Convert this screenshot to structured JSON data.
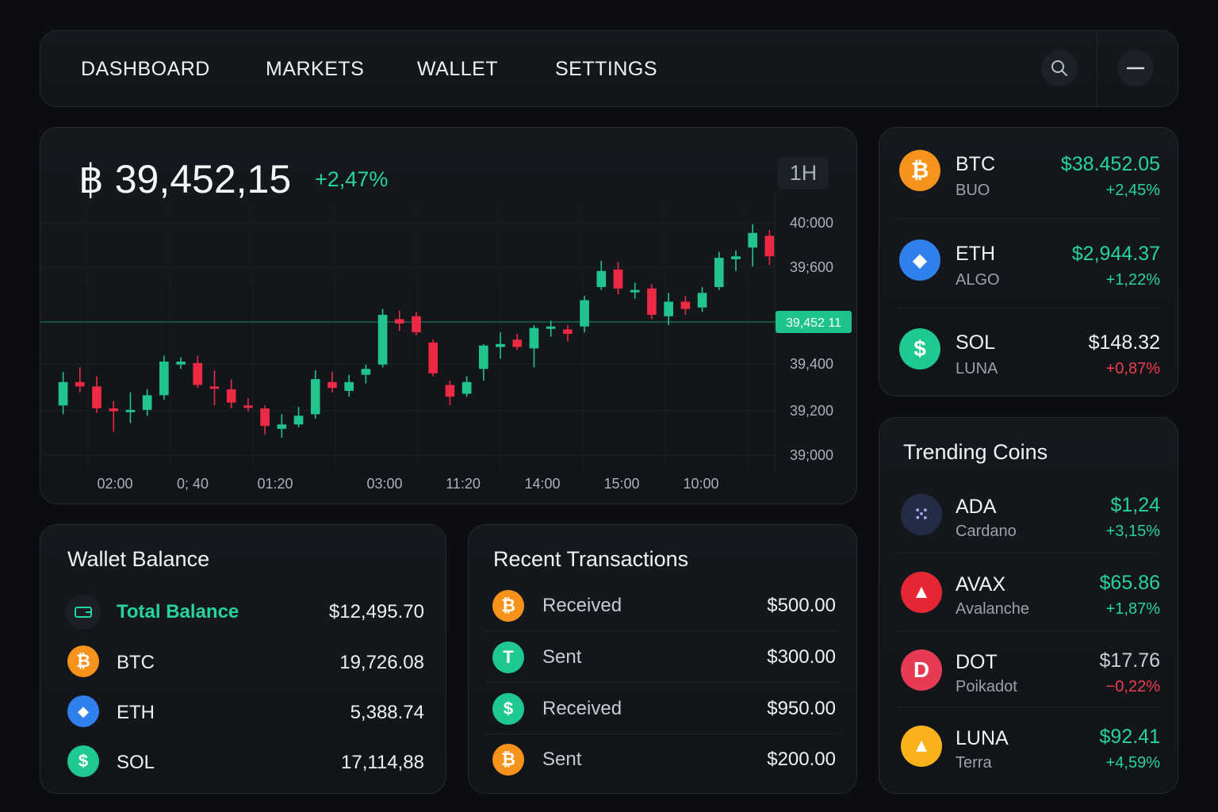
{
  "nav": {
    "items": [
      "DASHBOARD",
      "MARKETS",
      "WALLET",
      "SETTINGS"
    ],
    "search_icon": "search-icon",
    "menu_icon": "minus-icon"
  },
  "chart_panel": {
    "price": "฿ 39,452,15",
    "change": "+2,47%",
    "timeframe": "1H"
  },
  "chart_data": {
    "type": "candlestick",
    "y_ticks": [
      "40:000",
      "39;600",
      "39,400",
      "39,200",
      "39;000"
    ],
    "x_ticks": [
      "02:00",
      "0; 40",
      "01:20",
      "03:00",
      "11:20",
      "14:00",
      "15:00",
      "10:00"
    ],
    "current_price_label": "39,452 11",
    "current_price": 39452,
    "colors": {
      "up": "#22c48d",
      "down": "#ec2a43"
    },
    "candles": [
      {
        "o": 39170,
        "c": 39250,
        "h": 39285,
        "l": 39140
      },
      {
        "o": 39250,
        "c": 39235,
        "h": 39300,
        "l": 39215
      },
      {
        "o": 39235,
        "c": 39160,
        "h": 39270,
        "l": 39145
      },
      {
        "o": 39160,
        "c": 39150,
        "h": 39185,
        "l": 39080
      },
      {
        "o": 39150,
        "c": 39155,
        "h": 39215,
        "l": 39110
      },
      {
        "o": 39155,
        "c": 39205,
        "h": 39225,
        "l": 39135
      },
      {
        "o": 39205,
        "c": 39320,
        "h": 39340,
        "l": 39190
      },
      {
        "o": 39310,
        "c": 39320,
        "h": 39335,
        "l": 39295
      },
      {
        "o": 39315,
        "c": 39240,
        "h": 39340,
        "l": 39230
      },
      {
        "o": 39235,
        "c": 39230,
        "h": 39290,
        "l": 39170
      },
      {
        "o": 39225,
        "c": 39180,
        "h": 39260,
        "l": 39160
      },
      {
        "o": 39170,
        "c": 39165,
        "h": 39195,
        "l": 39150
      },
      {
        "o": 39160,
        "c": 39100,
        "h": 39170,
        "l": 39070
      },
      {
        "o": 39090,
        "c": 39105,
        "h": 39140,
        "l": 39060
      },
      {
        "o": 39105,
        "c": 39135,
        "h": 39165,
        "l": 39095
      },
      {
        "o": 39140,
        "c": 39260,
        "h": 39290,
        "l": 39125
      },
      {
        "o": 39250,
        "c": 39230,
        "h": 39285,
        "l": 39215
      },
      {
        "o": 39220,
        "c": 39250,
        "h": 39275,
        "l": 39200
      },
      {
        "o": 39275,
        "c": 39295,
        "h": 39310,
        "l": 39245
      },
      {
        "o": 39310,
        "c": 39480,
        "h": 39500,
        "l": 39300
      },
      {
        "o": 39465,
        "c": 39450,
        "h": 39495,
        "l": 39425
      },
      {
        "o": 39475,
        "c": 39420,
        "h": 39490,
        "l": 39410
      },
      {
        "o": 39385,
        "c": 39280,
        "h": 39395,
        "l": 39270
      },
      {
        "o": 39240,
        "c": 39200,
        "h": 39255,
        "l": 39170
      },
      {
        "o": 39210,
        "c": 39250,
        "h": 39270,
        "l": 39200
      },
      {
        "o": 39295,
        "c": 39375,
        "h": 39380,
        "l": 39255
      },
      {
        "o": 39370,
        "c": 39380,
        "h": 39420,
        "l": 39330
      },
      {
        "o": 39395,
        "c": 39370,
        "h": 39415,
        "l": 39360
      },
      {
        "o": 39365,
        "c": 39435,
        "h": 39445,
        "l": 39300
      },
      {
        "o": 39440,
        "c": 39440,
        "h": 39460,
        "l": 39405
      },
      {
        "o": 39430,
        "c": 39415,
        "h": 39445,
        "l": 39390
      },
      {
        "o": 39440,
        "c": 39530,
        "h": 39545,
        "l": 39420
      },
      {
        "o": 39575,
        "c": 39630,
        "h": 39665,
        "l": 39565
      },
      {
        "o": 39635,
        "c": 39570,
        "h": 39660,
        "l": 39550
      },
      {
        "o": 39560,
        "c": 39565,
        "h": 39590,
        "l": 39535
      },
      {
        "o": 39570,
        "c": 39480,
        "h": 39585,
        "l": 39465
      },
      {
        "o": 39475,
        "c": 39525,
        "h": 39555,
        "l": 39445
      },
      {
        "o": 39525,
        "c": 39500,
        "h": 39545,
        "l": 39480
      },
      {
        "o": 39505,
        "c": 39555,
        "h": 39575,
        "l": 39490
      },
      {
        "o": 39575,
        "c": 39675,
        "h": 39695,
        "l": 39565
      },
      {
        "o": 39670,
        "c": 39680,
        "h": 39700,
        "l": 39630
      },
      {
        "o": 39710,
        "c": 39760,
        "h": 39790,
        "l": 39645
      },
      {
        "o": 39750,
        "c": 39680,
        "h": 39770,
        "l": 39650
      }
    ]
  },
  "tickers": [
    {
      "symbol": "BTC",
      "name": "BUO",
      "price": "$38.452.05",
      "change": "+2,45%",
      "icon": "bitcoin-icon",
      "color": "#f7931a",
      "glyph": "₿",
      "price_color": "green",
      "change_color": "green"
    },
    {
      "symbol": "ETH",
      "name": "ALGO",
      "price": "$2,944.37",
      "change": "+1,22%",
      "icon": "ethereum-icon",
      "color": "#2f80ed",
      "glyph": "◆",
      "price_color": "green",
      "change_color": "green"
    },
    {
      "symbol": "SOL",
      "name": "LUNA",
      "price": "$148.32",
      "change": "+0,87%",
      "icon": "dollar-icon",
      "color": "#1fc791",
      "glyph": "$",
      "price_color": "white",
      "change_color": "red"
    }
  ],
  "trending": {
    "title": "Trending Coins",
    "items": [
      {
        "symbol": "ADA",
        "name": "Cardano",
        "price": "$1,24",
        "change": "+3,15%",
        "icon": "cardano-icon",
        "color": "#2a3450",
        "glyph": "⁙",
        "price_color": "green",
        "change_color": "green"
      },
      {
        "symbol": "AVAX",
        "name": "Avalanche",
        "price": "$65.86",
        "change": "+1,87%",
        "icon": "avalanche-icon",
        "color": "#e52735",
        "glyph": "▲",
        "price_color": "green",
        "change_color": "green"
      },
      {
        "symbol": "DOT",
        "name": "Poikadot",
        "price": "$17.76",
        "change": "−0,22%",
        "icon": "polkadot-icon",
        "color": "#e63a55",
        "glyph": "D",
        "price_color": "white",
        "change_color": "red"
      },
      {
        "symbol": "LUNA",
        "name": "Terra",
        "price": "$92.41",
        "change": "+4,59%",
        "icon": "terra-icon",
        "color": "#f9b21a",
        "glyph": "▲",
        "price_color": "green",
        "change_color": "green"
      }
    ]
  },
  "wallet": {
    "title": "Wallet Balance",
    "total_label": "Total Balance",
    "total_value": "$12,495.70",
    "total_icon": "wallet-icon",
    "rows": [
      {
        "label": "BTC",
        "value": "19,726.08",
        "icon": "bitcoin-icon",
        "color": "#f7931a",
        "glyph": "₿"
      },
      {
        "label": "ETH",
        "value": "5,388.74",
        "icon": "ethereum-icon",
        "color": "#2f80ed",
        "glyph": "◆"
      },
      {
        "label": "SOL",
        "value": "17,114,88",
        "icon": "dollar-icon",
        "color": "#1fc791",
        "glyph": "$"
      }
    ]
  },
  "transactions": {
    "title": "Recent Transactions",
    "rows": [
      {
        "label": "Received",
        "amount": "$500.00",
        "icon": "bitcoin-icon",
        "color": "#f7931a",
        "glyph": "₿"
      },
      {
        "label": "Sent",
        "amount": "$300.00",
        "icon": "tether-icon",
        "color": "#1fc791",
        "glyph": "T"
      },
      {
        "label": "Received",
        "amount": "$950.00",
        "icon": "coin-icon",
        "color": "#1fc791",
        "glyph": "$"
      },
      {
        "label": "Sent",
        "amount": "$200.00",
        "icon": "bitcoin-icon",
        "color": "#f7931a",
        "glyph": "₿"
      }
    ]
  }
}
